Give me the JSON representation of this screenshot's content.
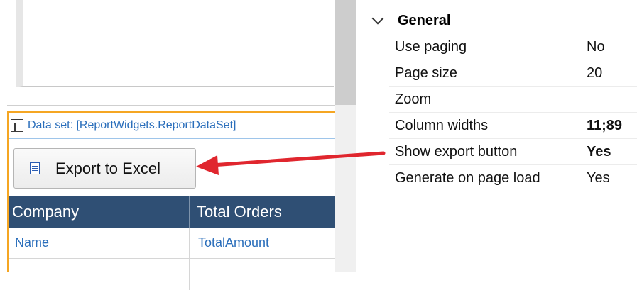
{
  "designer": {
    "dataset_label": "Data set: [ReportWidgets.ReportDataSet]",
    "export_button_label": "Export to Excel",
    "grid": {
      "columns": [
        "Company",
        "Total Orders"
      ],
      "rows": [
        [
          "Name",
          "TotalAmount"
        ],
        [
          "",
          ""
        ]
      ]
    }
  },
  "properties": {
    "group_label": "General",
    "rows": [
      {
        "name": "Use paging",
        "value": "No",
        "bold": false
      },
      {
        "name": "Page size",
        "value": "20",
        "bold": false
      },
      {
        "name": "Zoom",
        "value": "",
        "bold": false
      },
      {
        "name": "Column widths",
        "value": "11;89",
        "bold": true
      },
      {
        "name": "Show export button",
        "value": "Yes",
        "bold": true
      },
      {
        "name": "Generate on page load",
        "value": "Yes",
        "bold": false
      }
    ]
  },
  "colors": {
    "widget_border": "#f5a623",
    "grid_header": "#2f4f74",
    "link_text": "#2a6ebb",
    "annotation_arrow": "#e0262e"
  }
}
